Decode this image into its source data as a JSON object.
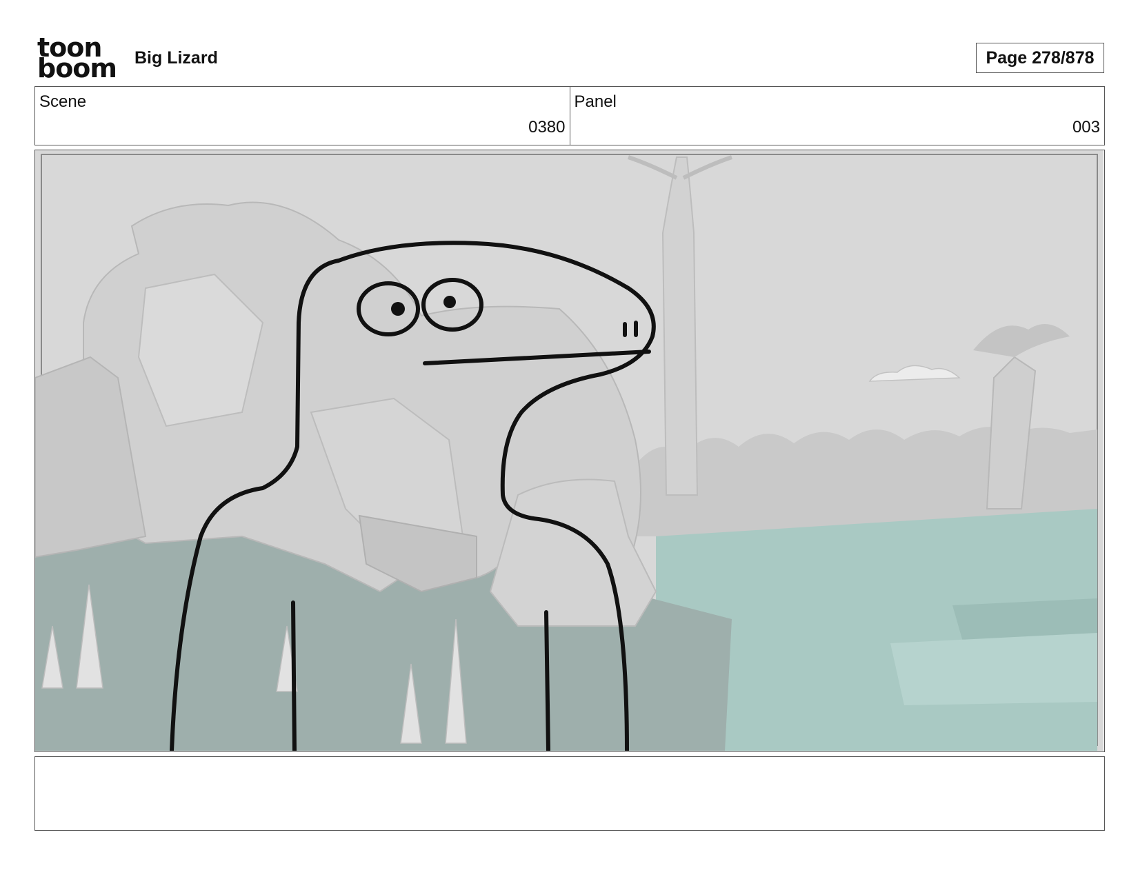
{
  "header": {
    "logo_line1": "toon",
    "logo_line2": "boom",
    "project_title": "Big Lizard",
    "page_indicator": "Page 278/878"
  },
  "info": {
    "scene_label": "Scene",
    "scene_value": "0380",
    "panel_label": "Panel",
    "panel_value": "003"
  },
  "panel": {
    "image_icon": "storyboard-drawing",
    "colors": {
      "sky": "#d6d6d6",
      "ground": "#9fb0ad",
      "water": "#a7c8c2",
      "rock": "#cfcfcf",
      "ink": "#111111"
    }
  },
  "notes": {
    "text": ""
  }
}
